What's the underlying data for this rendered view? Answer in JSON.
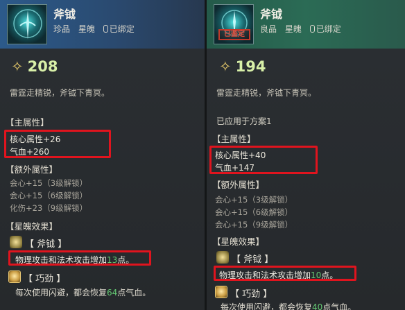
{
  "left": {
    "name": "斧钺",
    "quality": "珍品",
    "type": "星魄",
    "bind": "已绑定",
    "score": "208",
    "desc": "雷霆走精锐，斧钺下青冥。",
    "main_title": "【主属性】",
    "main_attrs": [
      "核心属性+26",
      "气血+260"
    ],
    "extra_title": "【额外属性】",
    "extra_attrs": [
      "会心+15（3级解锁）",
      "会心+15（6级解锁）",
      "化伤+23（9级解锁）"
    ],
    "effect_title": "【星魄效果】",
    "effect1_title": "【 斧钺 】",
    "effect1_pre": "物理攻击和法术攻击增加",
    "effect1_num": "13",
    "effect1_post": "点。",
    "effect2_title": "【 巧劲 】",
    "effect2_pre": "每次使用闪避，都会恢复",
    "effect2_num": "64",
    "effect2_post": "点气血。"
  },
  "right": {
    "name": "斧钺",
    "quality": "良品",
    "type": "星魄",
    "bind": "已绑定",
    "stamp": "已鉴定",
    "score": "194",
    "desc": "雷霆走精锐，斧钺下青冥。",
    "applied": "已应用于方案1",
    "main_title": "【主属性】",
    "main_attrs": [
      "核心属性+40",
      "气血+147"
    ],
    "extra_title": "【额外属性】",
    "extra_attrs": [
      "会心+15（3级解锁）",
      "会心+15（6级解锁）",
      "会心+15（9级解锁）"
    ],
    "effect_title": "【星魄效果】",
    "effect1_title": "【 斧钺 】",
    "effect1_pre": "物理攻击和法术攻击增加",
    "effect1_num": "10",
    "effect1_post": "点。",
    "effect2_title": "【 巧劲 】",
    "effect2_pre": "每次使用闪避，都会恢复",
    "effect2_num": "40",
    "effect2_post": "点气血。"
  },
  "colors": {
    "highlight_box": "#e0141e",
    "effect_number": "#64c873",
    "score_text": "#d8f0a8"
  },
  "icons": [
    "star-rune-icon",
    "lock-bind-icon",
    "axe-effect-icon",
    "agility-skill-icon"
  ]
}
